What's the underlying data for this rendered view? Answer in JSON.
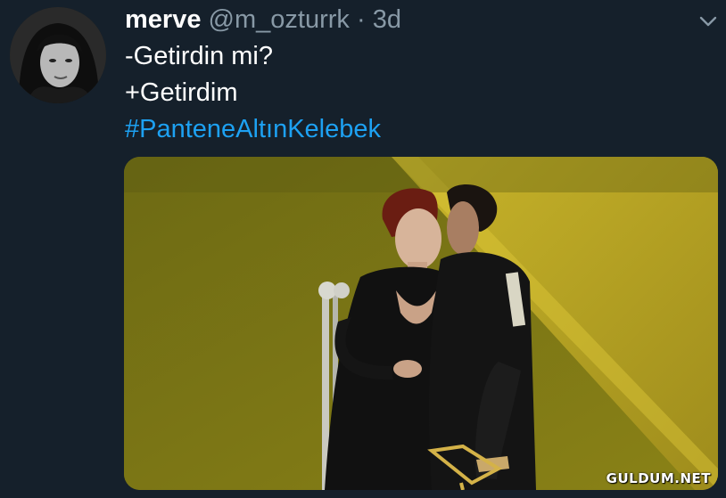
{
  "tweet": {
    "display_name": "merve",
    "handle": "@m_ozturrk",
    "separator": "·",
    "time": "3d",
    "text_lines": [
      "-Getirdin mi?",
      "+Getirdim"
    ],
    "hashtag": "#PanteneAltınKelebek"
  },
  "media": {
    "watermark": "GULDUM.NET"
  },
  "icons": {
    "menu": "chevron-down-icon",
    "avatar": "profile-photo"
  },
  "colors": {
    "background": "#15202b",
    "text": "#ffffff",
    "secondary": "#8899a6",
    "link": "#1da1f2"
  }
}
